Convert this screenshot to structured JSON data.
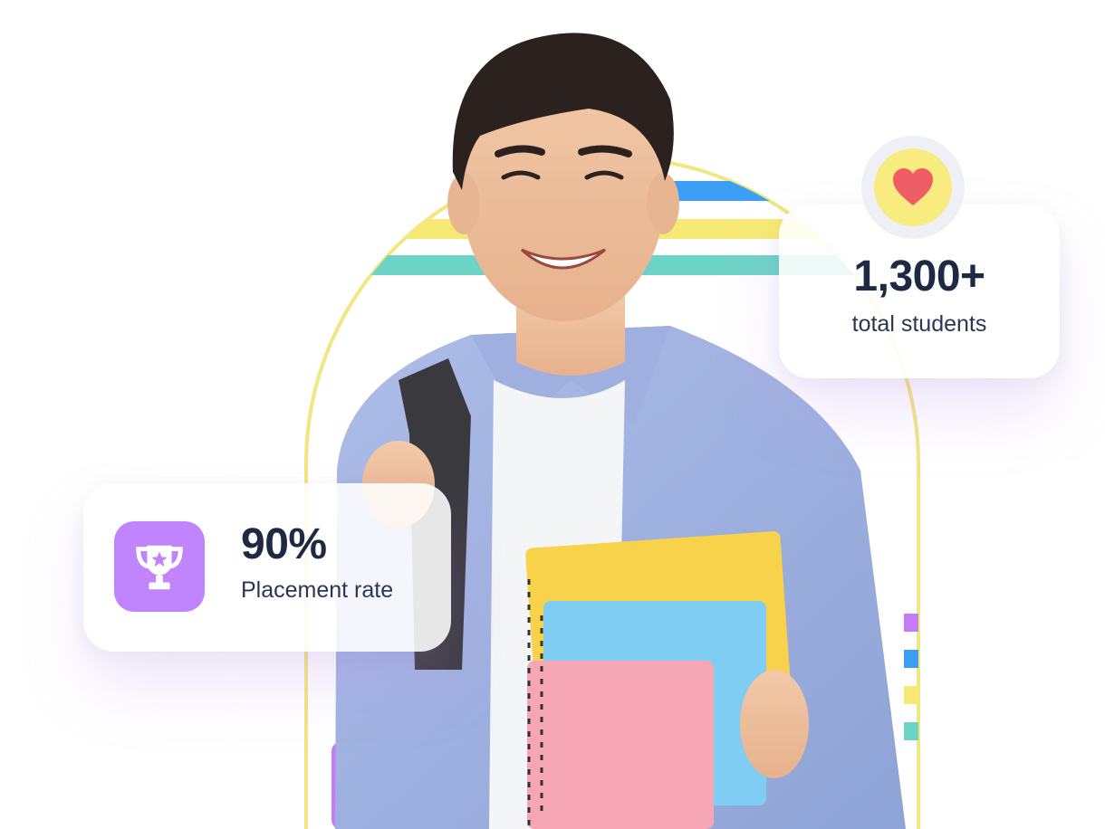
{
  "stats": {
    "placement": {
      "value": "90%",
      "label": "Placement rate",
      "icon": "trophy-icon"
    },
    "students": {
      "value": "1,300+",
      "label": "total students",
      "icon": "heart-icon"
    }
  },
  "colors": {
    "arch_outline": "#f2e680",
    "stripe_blue": "#3d9ef5",
    "stripe_yellow": "#f7ea74",
    "stripe_teal": "#6ed3c7",
    "stripe_purple": "#c67cf7",
    "trophy_badge": "#c084fc",
    "heart_circle": "#f8ec80",
    "heart": "#ef5d64",
    "text_dark": "#1e2a44"
  }
}
